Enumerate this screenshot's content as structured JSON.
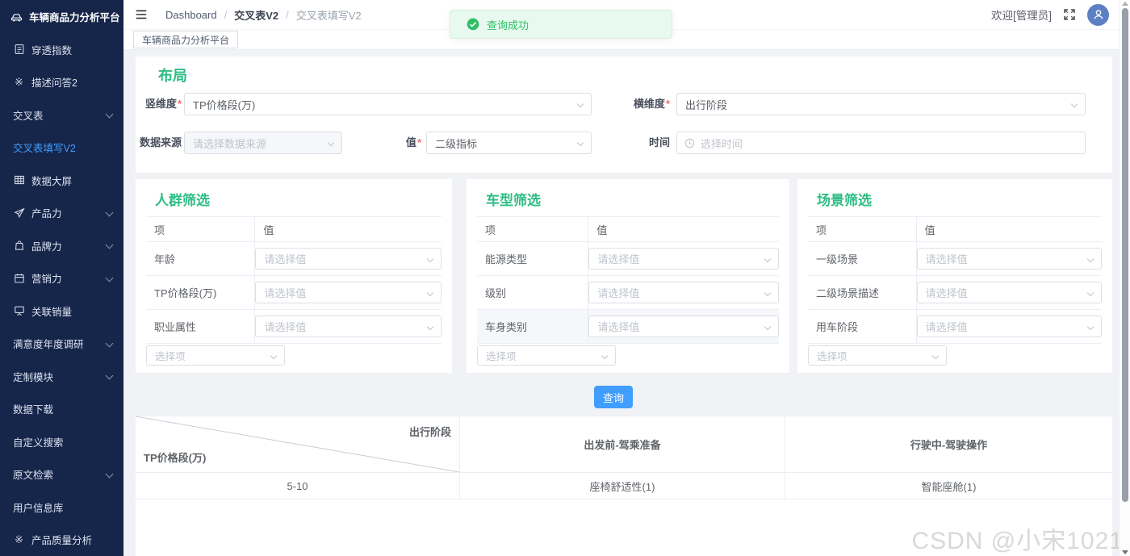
{
  "colors": {
    "accent_green": "#2ebd85",
    "primary_blue": "#409eff",
    "sidebar_bg": "#16254a",
    "toast_green": "#2fbf66"
  },
  "sidebar": {
    "logo_title": "车辆商品力分析平台",
    "items": [
      {
        "label": "穿透指数"
      },
      {
        "label": "描述问答2"
      },
      {
        "label": "交叉表"
      },
      {
        "label": "交叉表填写V2"
      },
      {
        "label": "数据大屏"
      },
      {
        "label": "产品力"
      },
      {
        "label": "品牌力"
      },
      {
        "label": "营销力"
      },
      {
        "label": "关联销量"
      },
      {
        "label": "满意度年度调研"
      },
      {
        "label": "定制模块"
      },
      {
        "label": "数据下载"
      },
      {
        "label": "自定义搜索"
      },
      {
        "label": "原文检索"
      },
      {
        "label": "用户信息库"
      },
      {
        "label": "产品质量分析"
      }
    ]
  },
  "topbar": {
    "breadcrumb": [
      "Dashboard",
      "交叉表V2",
      "交叉表填写V2"
    ],
    "separator": "/",
    "welcome": "欢迎[管理员]"
  },
  "toast": {
    "message": "查询成功"
  },
  "tabbar": {
    "active_tab": "车辆商品力分析平台"
  },
  "layout_panel": {
    "title": "布局",
    "required_mark": "*",
    "vertical": {
      "label": "竖维度",
      "value": "TP价格段(万)"
    },
    "horizontal": {
      "label": "横维度",
      "value": "出行阶段"
    },
    "source": {
      "label": "数据来源",
      "placeholder": "请选择数据来源"
    },
    "value": {
      "label": "值",
      "value": "二级指标"
    },
    "time": {
      "label": "时间",
      "placeholder": "选择时间"
    }
  },
  "filters": {
    "panels": [
      {
        "title": "人群筛选",
        "col_item": "项",
        "col_value": "值",
        "rows": [
          "年龄",
          "TP价格段(万)",
          "职业属性"
        ],
        "value_placeholder": "请选择值",
        "item_placeholder": "选择项"
      },
      {
        "title": "车型筛选",
        "col_item": "项",
        "col_value": "值",
        "rows": [
          "能源类型",
          "级别",
          "车身类别"
        ],
        "value_placeholder": "请选择值",
        "item_placeholder": "选择项"
      },
      {
        "title": "场景筛选",
        "col_item": "项",
        "col_value": "值",
        "rows": [
          "一级场景",
          "二级场景描述",
          "用车阶段"
        ],
        "value_placeholder": "请选择值",
        "item_placeholder": "选择项"
      }
    ]
  },
  "query_button": {
    "label": "查询"
  },
  "result_table": {
    "corner_top": "出行阶段",
    "corner_bottom": "TP价格段(万)",
    "columns": [
      "出发前-驾乘准备",
      "行驶中-驾驶操作"
    ],
    "rows": [
      {
        "dimension": "5-10",
        "values": [
          "座椅舒适性(1)",
          "智能座舱(1)"
        ]
      }
    ]
  },
  "watermark": "CSDN @小宋1021"
}
